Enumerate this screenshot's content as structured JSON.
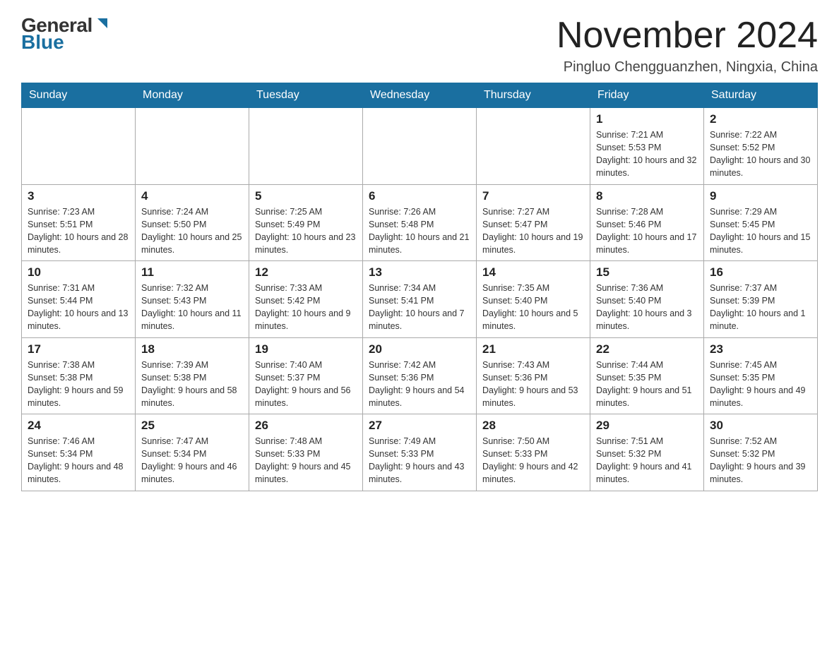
{
  "logo": {
    "general": "General",
    "blue": "Blue"
  },
  "title": "November 2024",
  "location": "Pingluo Chengguanzhen, Ningxia, China",
  "weekdays": [
    "Sunday",
    "Monday",
    "Tuesday",
    "Wednesday",
    "Thursday",
    "Friday",
    "Saturday"
  ],
  "weeks": [
    [
      {
        "day": "",
        "info": ""
      },
      {
        "day": "",
        "info": ""
      },
      {
        "day": "",
        "info": ""
      },
      {
        "day": "",
        "info": ""
      },
      {
        "day": "",
        "info": ""
      },
      {
        "day": "1",
        "info": "Sunrise: 7:21 AM\nSunset: 5:53 PM\nDaylight: 10 hours and 32 minutes."
      },
      {
        "day": "2",
        "info": "Sunrise: 7:22 AM\nSunset: 5:52 PM\nDaylight: 10 hours and 30 minutes."
      }
    ],
    [
      {
        "day": "3",
        "info": "Sunrise: 7:23 AM\nSunset: 5:51 PM\nDaylight: 10 hours and 28 minutes."
      },
      {
        "day": "4",
        "info": "Sunrise: 7:24 AM\nSunset: 5:50 PM\nDaylight: 10 hours and 25 minutes."
      },
      {
        "day": "5",
        "info": "Sunrise: 7:25 AM\nSunset: 5:49 PM\nDaylight: 10 hours and 23 minutes."
      },
      {
        "day": "6",
        "info": "Sunrise: 7:26 AM\nSunset: 5:48 PM\nDaylight: 10 hours and 21 minutes."
      },
      {
        "day": "7",
        "info": "Sunrise: 7:27 AM\nSunset: 5:47 PM\nDaylight: 10 hours and 19 minutes."
      },
      {
        "day": "8",
        "info": "Sunrise: 7:28 AM\nSunset: 5:46 PM\nDaylight: 10 hours and 17 minutes."
      },
      {
        "day": "9",
        "info": "Sunrise: 7:29 AM\nSunset: 5:45 PM\nDaylight: 10 hours and 15 minutes."
      }
    ],
    [
      {
        "day": "10",
        "info": "Sunrise: 7:31 AM\nSunset: 5:44 PM\nDaylight: 10 hours and 13 minutes."
      },
      {
        "day": "11",
        "info": "Sunrise: 7:32 AM\nSunset: 5:43 PM\nDaylight: 10 hours and 11 minutes."
      },
      {
        "day": "12",
        "info": "Sunrise: 7:33 AM\nSunset: 5:42 PM\nDaylight: 10 hours and 9 minutes."
      },
      {
        "day": "13",
        "info": "Sunrise: 7:34 AM\nSunset: 5:41 PM\nDaylight: 10 hours and 7 minutes."
      },
      {
        "day": "14",
        "info": "Sunrise: 7:35 AM\nSunset: 5:40 PM\nDaylight: 10 hours and 5 minutes."
      },
      {
        "day": "15",
        "info": "Sunrise: 7:36 AM\nSunset: 5:40 PM\nDaylight: 10 hours and 3 minutes."
      },
      {
        "day": "16",
        "info": "Sunrise: 7:37 AM\nSunset: 5:39 PM\nDaylight: 10 hours and 1 minute."
      }
    ],
    [
      {
        "day": "17",
        "info": "Sunrise: 7:38 AM\nSunset: 5:38 PM\nDaylight: 9 hours and 59 minutes."
      },
      {
        "day": "18",
        "info": "Sunrise: 7:39 AM\nSunset: 5:38 PM\nDaylight: 9 hours and 58 minutes."
      },
      {
        "day": "19",
        "info": "Sunrise: 7:40 AM\nSunset: 5:37 PM\nDaylight: 9 hours and 56 minutes."
      },
      {
        "day": "20",
        "info": "Sunrise: 7:42 AM\nSunset: 5:36 PM\nDaylight: 9 hours and 54 minutes."
      },
      {
        "day": "21",
        "info": "Sunrise: 7:43 AM\nSunset: 5:36 PM\nDaylight: 9 hours and 53 minutes."
      },
      {
        "day": "22",
        "info": "Sunrise: 7:44 AM\nSunset: 5:35 PM\nDaylight: 9 hours and 51 minutes."
      },
      {
        "day": "23",
        "info": "Sunrise: 7:45 AM\nSunset: 5:35 PM\nDaylight: 9 hours and 49 minutes."
      }
    ],
    [
      {
        "day": "24",
        "info": "Sunrise: 7:46 AM\nSunset: 5:34 PM\nDaylight: 9 hours and 48 minutes."
      },
      {
        "day": "25",
        "info": "Sunrise: 7:47 AM\nSunset: 5:34 PM\nDaylight: 9 hours and 46 minutes."
      },
      {
        "day": "26",
        "info": "Sunrise: 7:48 AM\nSunset: 5:33 PM\nDaylight: 9 hours and 45 minutes."
      },
      {
        "day": "27",
        "info": "Sunrise: 7:49 AM\nSunset: 5:33 PM\nDaylight: 9 hours and 43 minutes."
      },
      {
        "day": "28",
        "info": "Sunrise: 7:50 AM\nSunset: 5:33 PM\nDaylight: 9 hours and 42 minutes."
      },
      {
        "day": "29",
        "info": "Sunrise: 7:51 AM\nSunset: 5:32 PM\nDaylight: 9 hours and 41 minutes."
      },
      {
        "day": "30",
        "info": "Sunrise: 7:52 AM\nSunset: 5:32 PM\nDaylight: 9 hours and 39 minutes."
      }
    ]
  ]
}
